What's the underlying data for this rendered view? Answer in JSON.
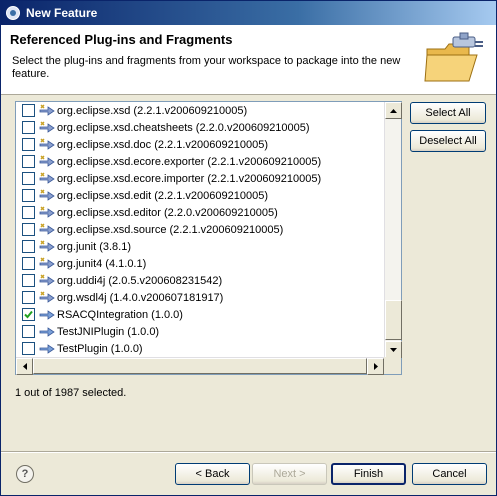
{
  "window": {
    "title": "New Feature"
  },
  "header": {
    "title": "Referenced Plug-ins and Fragments",
    "description": "Select the plug-ins and fragments from your workspace to package into the new feature."
  },
  "plugins": [
    {
      "label": "org.eclipse.xsd (2.2.1.v200609210005)",
      "checked": false,
      "icon": "plugin-icon"
    },
    {
      "label": "org.eclipse.xsd.cheatsheets (2.2.0.v200609210005)",
      "checked": false,
      "icon": "plugin-icon"
    },
    {
      "label": "org.eclipse.xsd.doc (2.2.1.v200609210005)",
      "checked": false,
      "icon": "plugin-icon"
    },
    {
      "label": "org.eclipse.xsd.ecore.exporter (2.2.1.v200609210005)",
      "checked": false,
      "icon": "plugin-icon"
    },
    {
      "label": "org.eclipse.xsd.ecore.importer (2.2.1.v200609210005)",
      "checked": false,
      "icon": "plugin-icon"
    },
    {
      "label": "org.eclipse.xsd.edit (2.2.1.v200609210005)",
      "checked": false,
      "icon": "plugin-icon"
    },
    {
      "label": "org.eclipse.xsd.editor (2.2.0.v200609210005)",
      "checked": false,
      "icon": "plugin-icon"
    },
    {
      "label": "org.eclipse.xsd.source (2.2.1.v200609210005)",
      "checked": false,
      "icon": "plugin-icon"
    },
    {
      "label": "org.junit (3.8.1)",
      "checked": false,
      "icon": "plugin-icon"
    },
    {
      "label": "org.junit4 (4.1.0.1)",
      "checked": false,
      "icon": "plugin-icon"
    },
    {
      "label": "org.uddi4j (2.0.5.v200608231542)",
      "checked": false,
      "icon": "plugin-icon"
    },
    {
      "label": "org.wsdl4j (1.4.0.v200607181917)",
      "checked": false,
      "icon": "plugin-icon"
    },
    {
      "label": "RSACQIntegration (1.0.0)",
      "checked": true,
      "icon": "workspace-plugin-icon"
    },
    {
      "label": "TestJNIPlugin (1.0.0)",
      "checked": false,
      "icon": "workspace-plugin-icon"
    },
    {
      "label": "TestPlugin (1.0.0)",
      "checked": false,
      "icon": "workspace-plugin-icon"
    }
  ],
  "buttons": {
    "select_all": "Select All",
    "deselect_all": "Deselect All",
    "back": "< Back",
    "next": "Next >",
    "finish": "Finish",
    "cancel": "Cancel"
  },
  "status": "1 out of 1987 selected.",
  "help": "?"
}
